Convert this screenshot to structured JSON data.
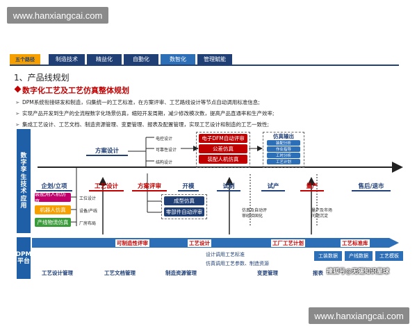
{
  "watermark_top": "www.hanxiangcai.com",
  "watermark_bottom": "www.hanxiangcai.com",
  "watermark_corner": "搜狐号@无锡知识星球",
  "tabs": [
    {
      "label": "五个路径"
    },
    {
      "label": "制造技术"
    },
    {
      "label": "精益化"
    },
    {
      "label": "自動化"
    },
    {
      "label": "数智化"
    },
    {
      "label": "管理賦能"
    }
  ],
  "section_title": "1、产品线规划",
  "subtitle": "数字化工艺及工艺仿真整体规划",
  "bullets": [
    "DPM系统衔接研发和制造，归集统一的工艺标准，在方案评审、工艺路线设计等节点自动调用标准信息;",
    "实现产品开发到生产的全流程数字化场景仿真，缩短开发周期，减少修改模次数，提高产品直通率和生产效率;",
    "集成工艺设计、工艺文档、制造资源管理、变更管理、报表及配置管理，实现工艺设计和制造的工艺一致性;"
  ],
  "side_labels": {
    "top": "数字孪生技术应用",
    "bottom": "DPM平台"
  },
  "top_branch": {
    "main": "方案设计",
    "sub": [
      "电控设计",
      "可靠性设计",
      "结构设计"
    ]
  },
  "sim_boxes": [
    "电子DFM自动评审",
    "公差仿真",
    "装配人机仿真"
  ],
  "sim_output": {
    "title": "仿真输出",
    "items": [
      "装配分析",
      "作业指导",
      "工时分析",
      "工艺计划"
    ]
  },
  "stages": [
    {
      "label": "企划/立项",
      "red": false
    },
    {
      "label": "工艺设计",
      "red": true
    },
    {
      "label": "方案评审",
      "red": true
    },
    {
      "label": "开模",
      "red": false
    },
    {
      "label": "试制",
      "red": false
    },
    {
      "label": "试产",
      "red": false
    },
    {
      "label": "量产",
      "red": true
    },
    {
      "label": "售后/退市",
      "red": false
    }
  ],
  "left_boxes": [
    "装配用人机仿真",
    "机器人仿真",
    "产线物流仿真"
  ],
  "left_labels": [
    "工位设计",
    "设备/产线",
    "厂房布局"
  ],
  "mid_boxes": [
    "成型仿真",
    "零部件自动评审"
  ],
  "notes": {
    "trial": "仿真及自动评\n审经验固化",
    "mass": "量产及市场\n问题沉淀"
  },
  "dpm": {
    "items": [
      "可制造性评审",
      "工艺设计",
      "工厂工艺计划",
      "工艺标准库"
    ],
    "subs": [
      "设计调用工艺标准",
      "仿真调用工艺参数、制造资源"
    ],
    "buttons": [
      "工装数据",
      "产线数据",
      "工艺模板"
    ],
    "bottom": [
      "工艺设计管理",
      "工艺文档管理",
      "制造资源管理",
      "变更管理",
      "报表"
    ]
  }
}
